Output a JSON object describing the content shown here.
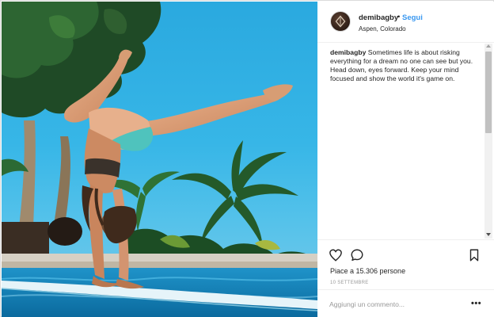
{
  "post": {
    "username": "demibagby",
    "separator": "•",
    "follow_label": "Segui",
    "location": "Aspen, Colorado",
    "caption_author": "demibagby",
    "caption_text": " Sometimes life is about risking everything for a dream no one can see but you. Head down, eyes forward. Keep your mind focused and show the world it's game on.",
    "likes": "Piace a 15.306 persone",
    "date": "10 SETTEMBRE",
    "comment_placeholder": "Aggiungi un commento...",
    "more_label": "•••"
  },
  "icons": {
    "like": "heart-icon",
    "comment": "speech-bubble-icon",
    "save": "bookmark-icon",
    "avatar": "avatar-image"
  },
  "colors": {
    "link_blue": "#3897f0",
    "text": "#262626",
    "muted": "#999999",
    "border": "#efefef"
  }
}
